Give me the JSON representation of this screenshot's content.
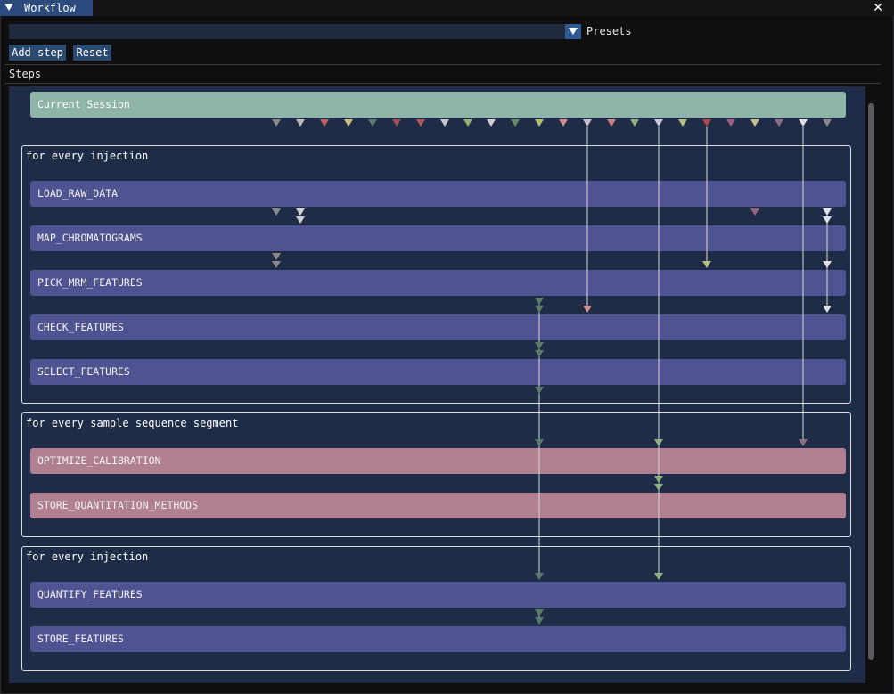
{
  "window": {
    "title": "Workflow",
    "close_glyph": "✕"
  },
  "presets": {
    "value": "",
    "label": "Presets"
  },
  "toolbar": {
    "add_step": "Add step",
    "reset": "Reset"
  },
  "steps_header": "Steps",
  "session": {
    "label": "Current Session"
  },
  "groups": [
    {
      "label": "for every injection",
      "steps": [
        "LOAD_RAW_DATA",
        "MAP_CHROMATOGRAMS",
        "PICK_MRM_FEATURES",
        "CHECK_FEATURES",
        "SELECT_FEATURES"
      ]
    },
    {
      "label": "for every sample sequence segment",
      "steps": [
        "OPTIMIZE_CALIBRATION",
        "STORE_QUANTITATION_METHODS"
      ]
    },
    {
      "label": "for every injection",
      "steps": [
        "QUANTIFY_FEATURES",
        "STORE_FEATURES"
      ]
    }
  ],
  "colors": {
    "accent": "#2b4a7e",
    "canvas": "#1e2c47",
    "session_node": "#8fb4a8",
    "injection_node": "#4f5391",
    "segment_node": "#b08090",
    "port_palette": [
      "#888888",
      "#b9b9b9",
      "#c06060",
      "#d0c080",
      "#5a7a6a",
      "#9a5050",
      "#b05858",
      "#c8c8c8",
      "#9ab070",
      "#d0d0d0",
      "#6a8a6a",
      "#b0c070",
      "#d09090",
      "#c0c0c0",
      "#d08080",
      "#90b080",
      "#c8c8d8",
      "#b8c080",
      "#b04848",
      "#a06080",
      "#c8c090",
      "#8a7080",
      "#e0e0e0"
    ]
  }
}
